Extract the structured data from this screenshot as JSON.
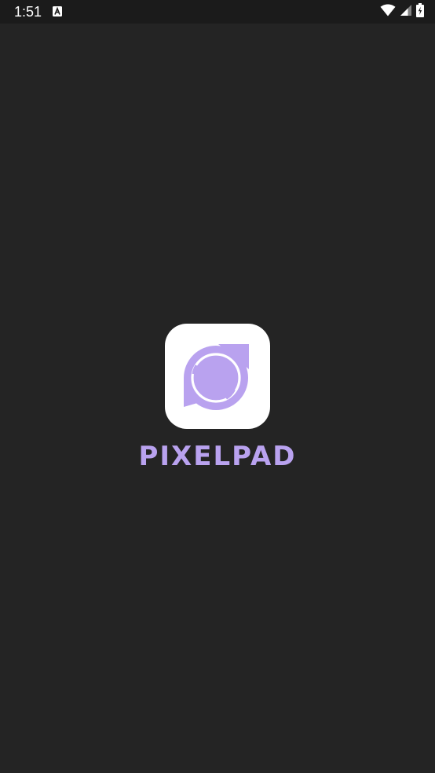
{
  "status_bar": {
    "time": "1:51",
    "notification_icon": "text-input-a-icon",
    "icons": [
      "wifi-icon",
      "cellular-signal-icon",
      "battery-charging-icon"
    ]
  },
  "splash": {
    "app_name": "PIXELPAD",
    "logo_icon": "chat-bubble-lens-icon"
  },
  "colors": {
    "background": "#242424",
    "status_bar": "#1b1b1b",
    "brand_purple": "#b9a2ef",
    "icon_tile": "#ffffff"
  }
}
